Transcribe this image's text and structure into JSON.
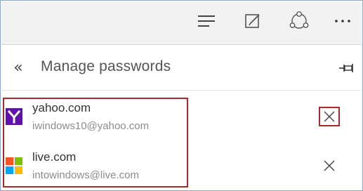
{
  "toolbar": {
    "buttons": [
      {
        "name": "hub-icon"
      },
      {
        "name": "web-note-icon"
      },
      {
        "name": "share-icon"
      },
      {
        "name": "more-icon",
        "label": "···"
      }
    ]
  },
  "panel": {
    "back_label": "«",
    "title": "Manage passwords",
    "pin_icon": "pin-icon"
  },
  "entries": [
    {
      "site": "yahoo.com",
      "user": "iwindows10@yahoo.com",
      "logo": "yahoo-logo-icon"
    },
    {
      "site": "live.com",
      "user": "intowindows@live.com",
      "logo": "windows-logo-icon"
    }
  ],
  "colors": {
    "toolbar_bg": "#f2f2f2",
    "highlight": "#a52a2a",
    "yahoo_purple": "#5f12a6",
    "windows_red": "#f35325",
    "windows_green": "#81bc06",
    "windows_blue": "#05a6f0",
    "windows_yellow": "#ffba08"
  }
}
